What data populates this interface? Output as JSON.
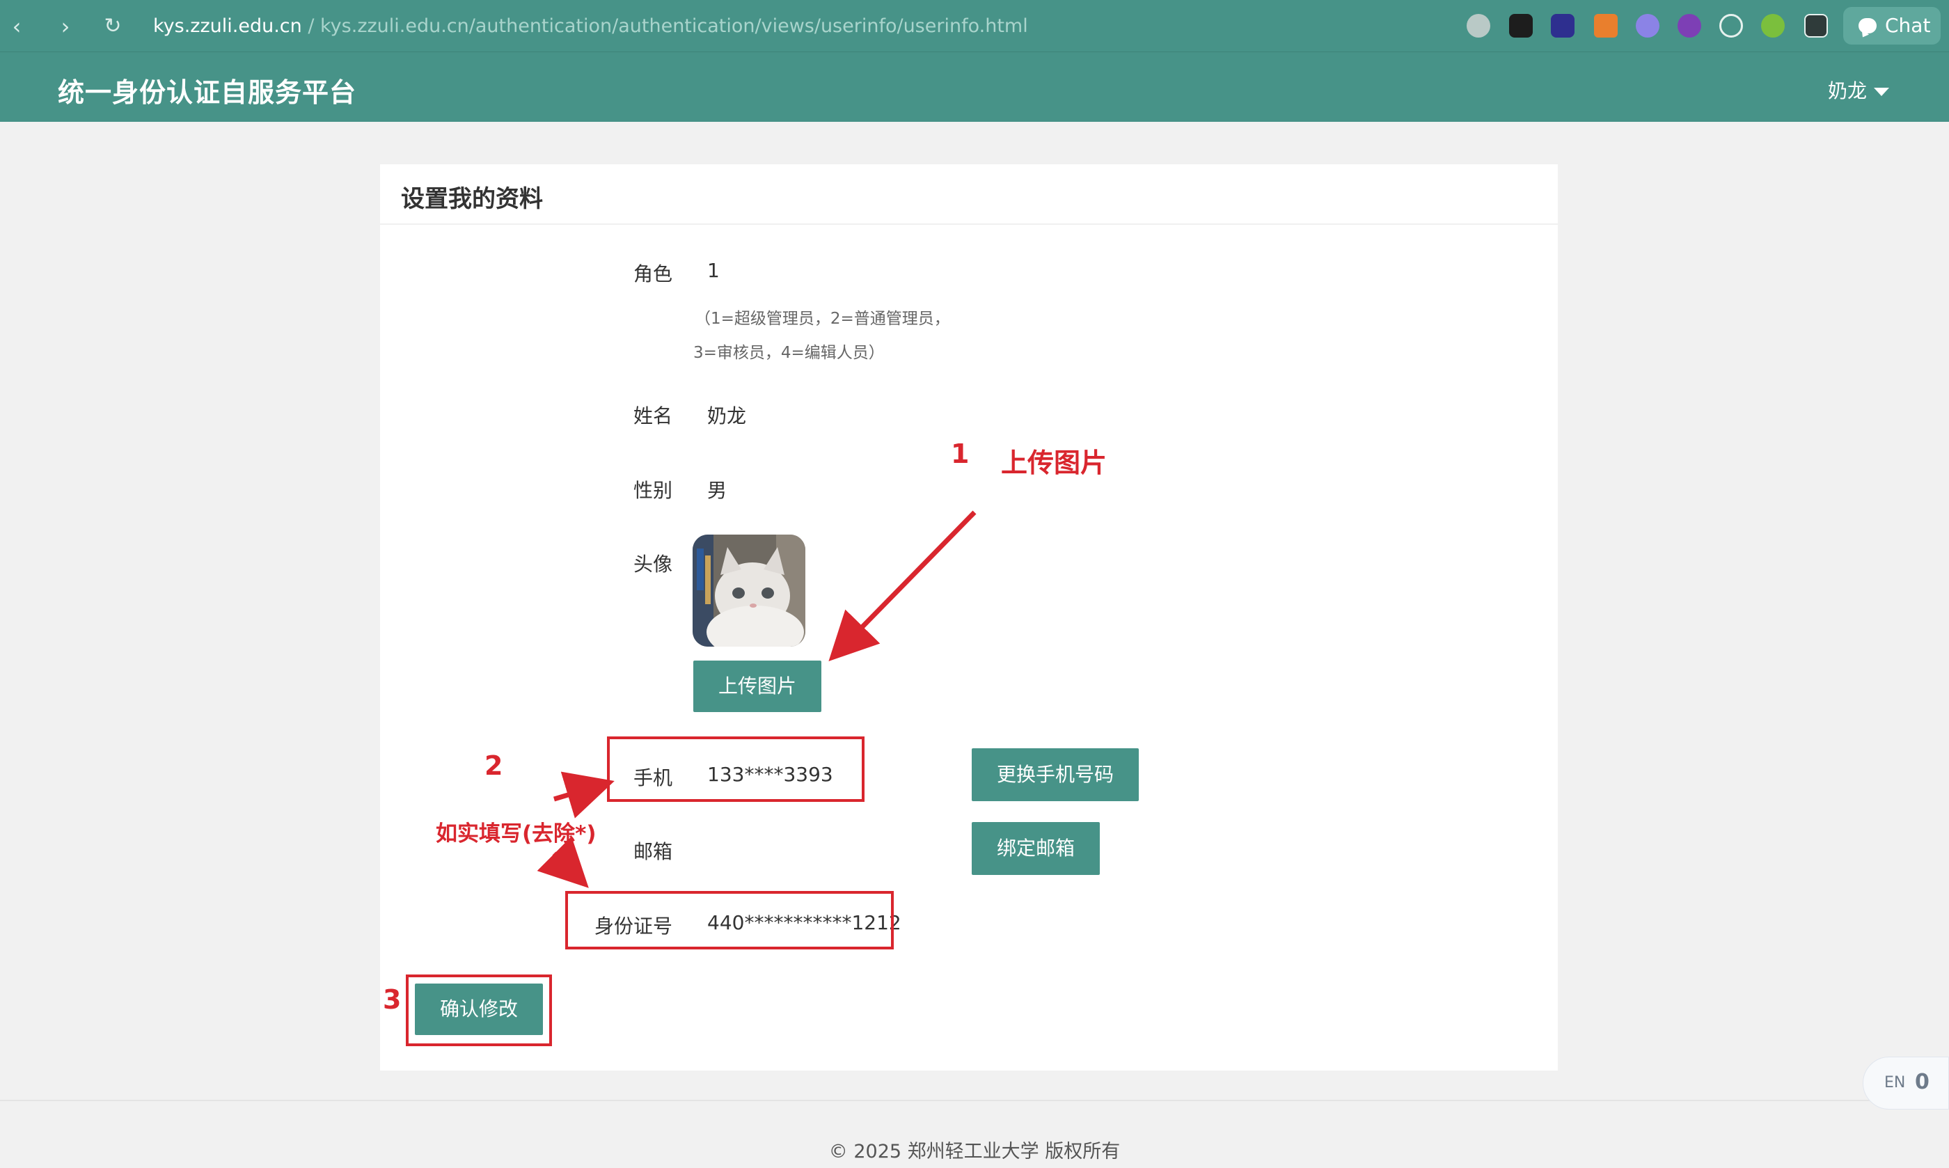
{
  "browser": {
    "url_host": "kys.zzuli.edu.cn",
    "url_path": " / kys.zzuli.edu.cn/authentication/authentication/views/userinfo/userinfo.html",
    "chat_label": "Chat"
  },
  "header": {
    "title": "统一身份认证自服务平台",
    "user_name": "奶龙"
  },
  "card": {
    "title": "设置我的资料",
    "role_label": "角色",
    "role_value": "1",
    "role_hint_1": "（1=超级管理员，2=普通管理员，",
    "role_hint_2": "3=审核员，4=编辑人员）",
    "name_label": "姓名",
    "name_value": "奶龙",
    "gender_label": "性别",
    "gender_value": "男",
    "avatar_label": "头像",
    "upload_button": "上传图片",
    "phone_label": "手机",
    "phone_value": "133****3393",
    "change_phone_button": "更换手机号码",
    "email_label": "邮箱",
    "bind_email_button": "绑定邮箱",
    "id_label": "身份证号",
    "id_value": "440***********1212",
    "confirm_button": "确认修改"
  },
  "annotations": {
    "step1_number": "1",
    "step1_text": "上传图片",
    "step2_number": "2",
    "step2_text": "如实填写(去除*)",
    "step3_number": "3"
  },
  "footer": {
    "copyright": "© 2025 郑州轻工业大学 版权所有"
  },
  "lang_widget": {
    "lang": "EN",
    "count": "0"
  },
  "colors": {
    "brand": "#479388",
    "annotation": "#d9262e"
  }
}
